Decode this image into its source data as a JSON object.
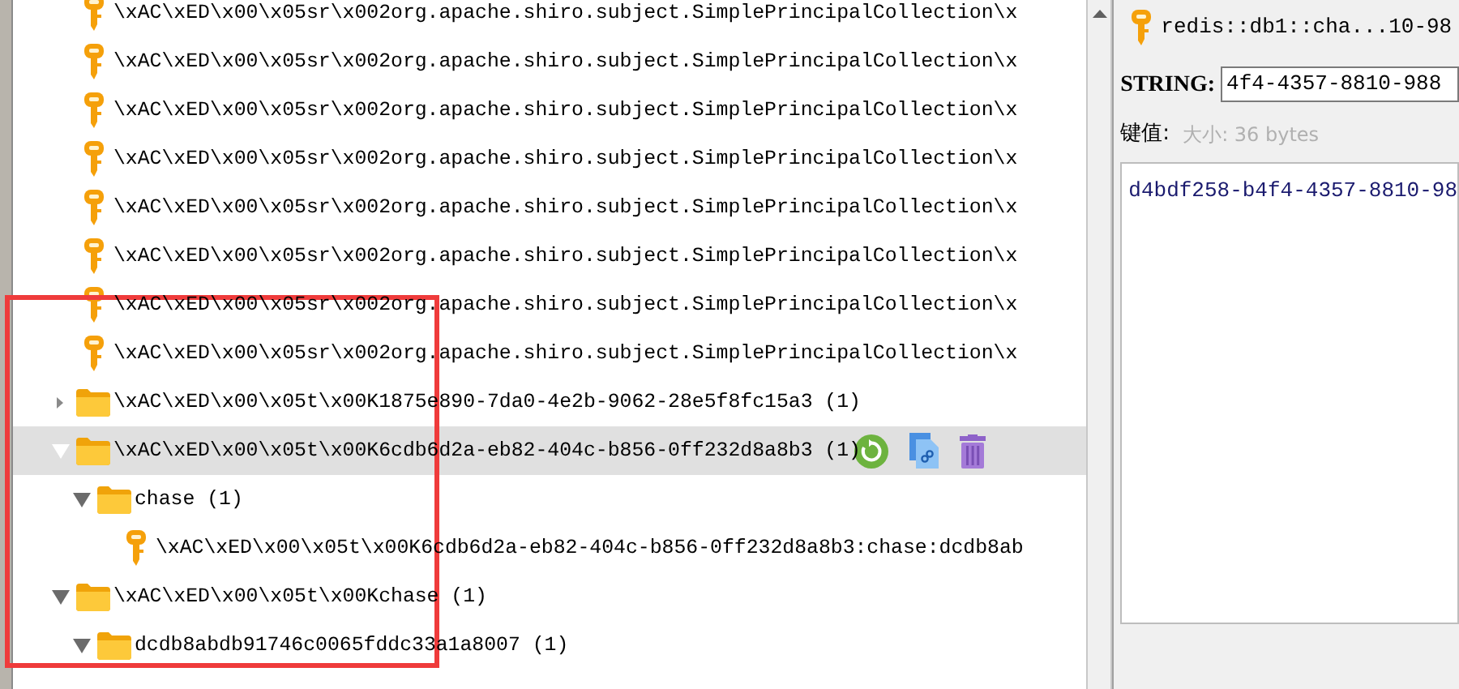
{
  "tree": [
    {
      "kind": "key",
      "label": "\\xAC\\xED\\x00\\x05sr\\x002org.apache.shiro.subject.SimplePrincipalCollection\\x",
      "selected": false
    },
    {
      "kind": "key",
      "label": "\\xAC\\xED\\x00\\x05sr\\x002org.apache.shiro.subject.SimplePrincipalCollection\\x",
      "selected": false
    },
    {
      "kind": "key",
      "label": "\\xAC\\xED\\x00\\x05sr\\x002org.apache.shiro.subject.SimplePrincipalCollection\\x",
      "selected": false
    },
    {
      "kind": "key",
      "label": "\\xAC\\xED\\x00\\x05sr\\x002org.apache.shiro.subject.SimplePrincipalCollection\\x",
      "selected": false
    },
    {
      "kind": "key",
      "label": "\\xAC\\xED\\x00\\x05sr\\x002org.apache.shiro.subject.SimplePrincipalCollection\\x",
      "selected": false
    },
    {
      "kind": "key",
      "label": "\\xAC\\xED\\x00\\x05sr\\x002org.apache.shiro.subject.SimplePrincipalCollection\\x",
      "selected": false
    },
    {
      "kind": "key",
      "label": "\\xAC\\xED\\x00\\x05sr\\x002org.apache.shiro.subject.SimplePrincipalCollection\\x",
      "selected": false
    },
    {
      "kind": "key",
      "label": "\\xAC\\xED\\x00\\x05sr\\x002org.apache.shiro.subject.SimplePrincipalCollection\\x",
      "selected": false
    },
    {
      "kind": "folder",
      "label": "\\xAC\\xED\\x00\\x05t\\x00K1875e890-7da0-4e2b-9062-28e5f8fc15a3 (1)",
      "expanded": false,
      "selected": false
    },
    {
      "kind": "folder",
      "label": "\\xAC\\xED\\x00\\x05t\\x00K6cdb6d2a-eb82-404c-b856-0ff232d8a8b3 (1)",
      "expanded": true,
      "selected": true,
      "children": [
        {
          "kind": "folder",
          "label": "chase (1)",
          "expanded": true,
          "selected": false,
          "children": [
            {
              "kind": "key",
              "label": "\\xAC\\xED\\x00\\x05t\\x00K6cdb6d2a-eb82-404c-b856-0ff232d8a8b3:chase:dcdb8ab",
              "selected": false
            }
          ]
        }
      ]
    },
    {
      "kind": "folder",
      "label": "\\xAC\\xED\\x00\\x05t\\x00Kchase (1)",
      "expanded": true,
      "selected": false,
      "children": [
        {
          "kind": "folder",
          "label": "dcdb8abdb91746c0065fddc33a1a8007 (1)",
          "expanded": true,
          "selected": false
        }
      ]
    }
  ],
  "panel": {
    "title": "redis::db1::cha...10-98",
    "type_label": "STRING:",
    "key_value": "4f4-4357-8810-988",
    "value_label": "键值:",
    "size": "大小: 36 bytes",
    "value": "d4bdf258-b4f4-4357-8810-98"
  }
}
